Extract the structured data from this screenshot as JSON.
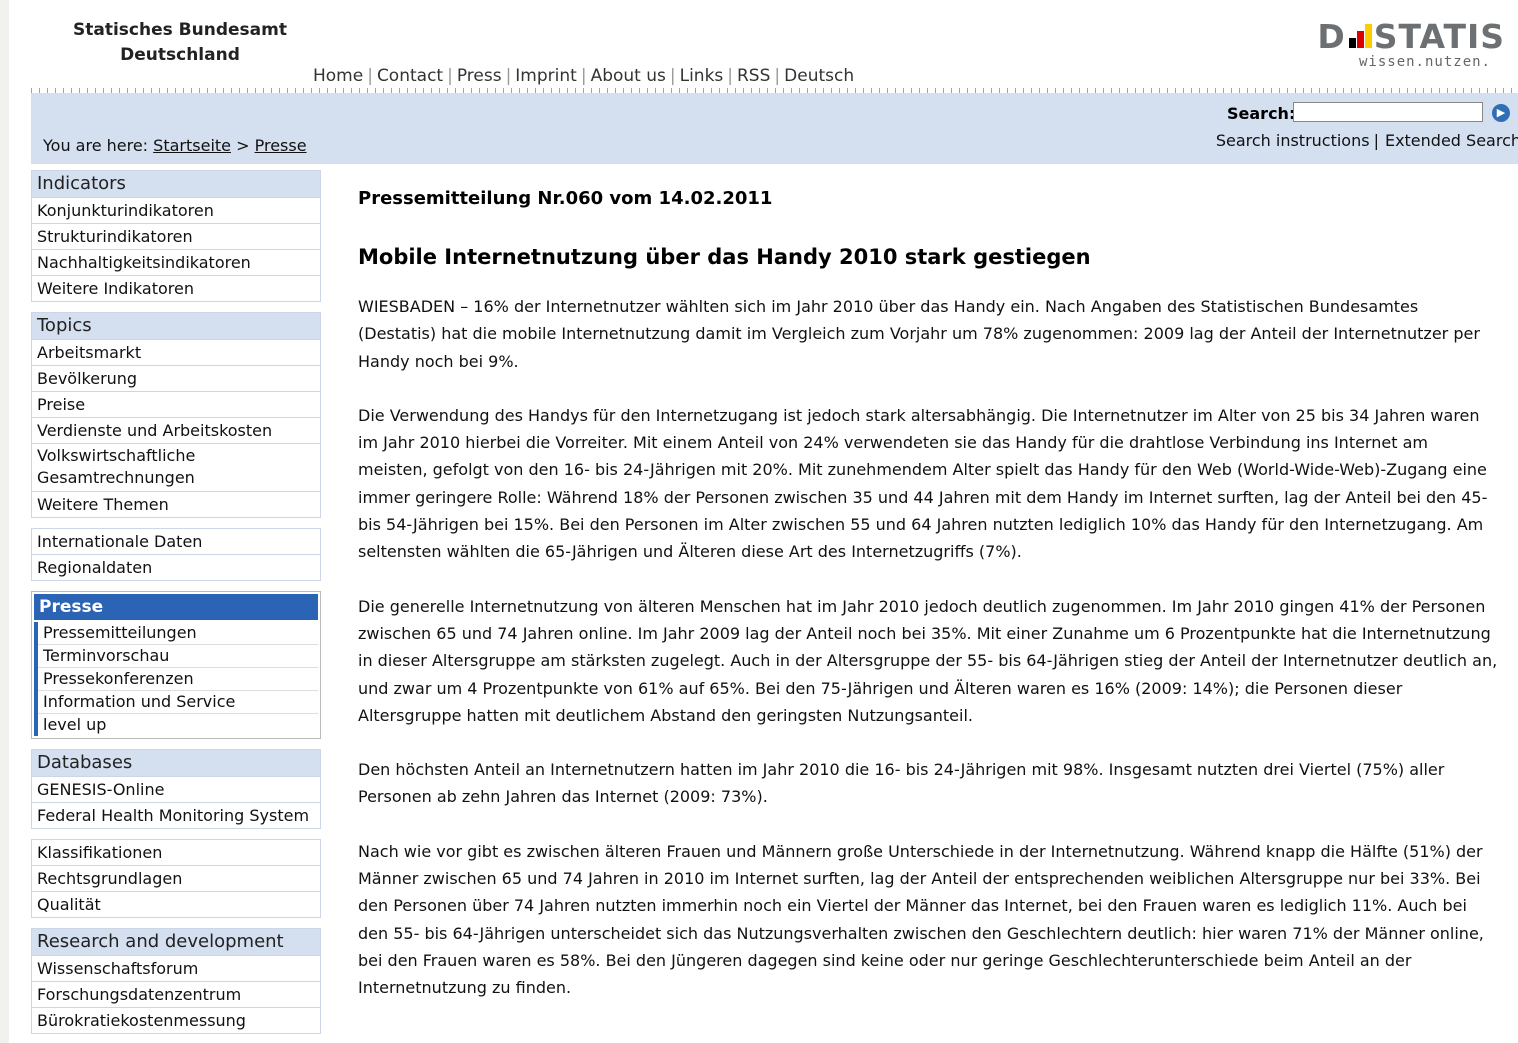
{
  "header": {
    "org_line1": "Statisches Bundesamt",
    "org_line2": "Deutschland",
    "logo_word_left": "D",
    "logo_word_right": "STATIS",
    "logo_tagline": "wissen.nutzen.",
    "nav": [
      "Home",
      "Contact",
      "Press",
      "Imprint",
      "About us",
      "Links",
      "RSS",
      "Deutsch"
    ]
  },
  "breadcrumb": {
    "prefix": "You are here:",
    "items": [
      "Startseite",
      "Presse"
    ],
    "separator": ">"
  },
  "search": {
    "label": "Search:",
    "value": "",
    "instructions": "Search instructions",
    "extended": "Extended Search"
  },
  "sidebar": {
    "indicators": {
      "heading": "Indicators",
      "items": [
        "Konjunkturindikatoren",
        "Strukturindikatoren",
        "Nachhaltigkeitsindikatoren",
        "Weitere Indikatoren"
      ]
    },
    "topics": {
      "heading": "Topics",
      "items": [
        "Arbeitsmarkt",
        "Bevölkerung",
        "Preise",
        "Verdienste und Arbeitskosten",
        "Volkswirtschaftliche Gesamtrechnungen",
        "Weitere Themen"
      ]
    },
    "data_links": [
      "Internationale Daten",
      "Regionaldaten"
    ],
    "presse": {
      "heading": "Presse",
      "items": [
        "Pressemitteilungen",
        "Terminvorschau",
        "Pressekonferenzen",
        "Information und Service",
        "level up"
      ]
    },
    "databases": {
      "heading": "Databases",
      "items": [
        "GENESIS-Online",
        "Federal Health Monitoring System"
      ]
    },
    "misc": [
      "Klassifikationen",
      "Rechtsgrundlagen",
      "Qualität"
    ],
    "research": {
      "heading": "Research and development",
      "items": [
        "Wissenschaftsforum",
        "Forschungsdatenzentrum",
        "Bürokratiekostenmessung"
      ]
    }
  },
  "article": {
    "press_number": "Pressemitteilung Nr.060 vom 14.02.2011",
    "headline": "Mobile Internetnutzung über das Handy 2010 stark gestiegen",
    "paragraphs": [
      "WIESBADEN – 16% der Internetnutzer wählten sich im Jahr 2010 über das Handy ein. Nach Angaben des Statistischen Bundesamtes (Destatis) hat die mobile Internetnutzung damit im Vergleich zum Vorjahr um 78% zugenommen: 2009 lag der Anteil der Internetnutzer per Handy noch bei 9%.",
      "Die Verwendung des Handys für den Internetzugang ist jedoch stark altersabhängig. Die Internetnutzer im Alter von 25 bis 34 Jahren waren im Jahr 2010 hierbei die Vorreiter. Mit einem Anteil von 24% verwendeten sie das Handy für die drahtlose Verbindung ins Internet am meisten, gefolgt von den 16- bis 24-Jährigen mit 20%. Mit zunehmendem Alter spielt das Handy für den Web (World-Wide-Web)-Zugang eine immer geringere Rolle: Während 18% der Personen zwischen 35 und 44 Jahren mit dem Handy im Internet surften, lag der Anteil bei den 45- bis 54-Jährigen bei 15%. Bei den Personen im Alter zwischen 55 und 64 Jahren nutzten lediglich 10% das Handy für den Internetzugang. Am seltensten wählten die 65-Jährigen und Älteren diese Art des Internetzugriffs (7%).",
      "Die generelle Internetnutzung von älteren Menschen hat im Jahr 2010 jedoch deutlich zugenommen. Im Jahr 2010 gingen 41% der Personen zwischen 65 und 74 Jahren online. Im Jahr 2009 lag der Anteil noch bei 35%. Mit einer Zunahme um 6 Prozentpunkte hat die Internetnutzung in dieser Altersgruppe am stärksten zugelegt. Auch in der Altersgruppe der 55- bis 64-Jährigen stieg der Anteil der Internetnutzer deutlich an, und zwar um 4 Prozentpunkte von 61% auf 65%. Bei den 75-Jährigen und Älteren waren es 16% (2009: 14%); die Personen dieser Altersgruppe hatten mit deutlichem Abstand den geringsten Nutzungsanteil.",
      "Den höchsten Anteil an Internetnutzern hatten im Jahr 2010 die 16- bis 24-Jährigen mit 98%. Insgesamt nutzten drei Viertel (75%) aller Personen ab zehn Jahren das Internet (2009: 73%).",
      "Nach wie vor gibt es zwischen älteren Frauen und Männern große Unterschiede in der Internetnutzung. Während knapp die Hälfte (51%) der Männer zwischen 65 und 74 Jahren in 2010 im Internet surften, lag der Anteil der entsprechenden weiblichen Altersgruppe nur bei 33%. Bei den Personen über 74 Jahren nutzten immerhin noch ein Viertel der Männer das Internet, bei den Frauen waren es lediglich 11%. Auch bei den 55- bis 64-Jährigen unterscheidet sich das Nutzungsverhalten zwischen den Geschlechtern deutlich: hier waren 71% der Männer online, bei den Frauen waren es 58%. Bei den Jüngeren dagegen sind keine oder nur geringe Geschlechterunterschiede beim Anteil an der Internetnutzung zu finden."
    ]
  },
  "colors": {
    "band": "#d4dff0",
    "active": "#2b63b5",
    "logo_grey": "#6d7073",
    "flag_black": "#000000",
    "flag_red": "#dd0000",
    "flag_gold": "#ffcc00"
  },
  "icons": {
    "search_go": "arrow-right-circle-icon"
  }
}
